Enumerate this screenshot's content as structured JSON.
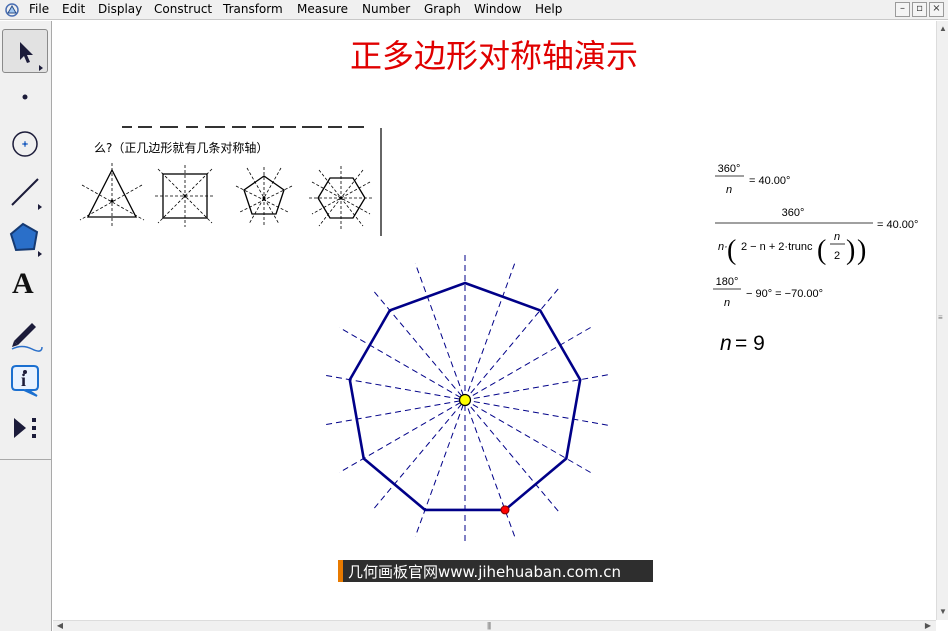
{
  "menu": {
    "items": [
      "File",
      "Edit",
      "Display",
      "Construct",
      "Transform",
      "Measure",
      "Number",
      "Graph",
      "Window",
      "Help"
    ]
  },
  "window_controls": {
    "minimize": "–",
    "restore": "▫",
    "close": "×"
  },
  "toolbox": {
    "tools": [
      {
        "name": "select-arrow-tool",
        "icon": "arrow-icon"
      },
      {
        "name": "point-tool",
        "icon": "point-icon"
      },
      {
        "name": "compass-tool",
        "icon": "circle-icon"
      },
      {
        "name": "straightedge-tool",
        "icon": "segment-icon"
      },
      {
        "name": "polygon-tool",
        "icon": "pentagon-icon"
      },
      {
        "name": "text-tool",
        "icon": "text-A-icon"
      },
      {
        "name": "marker-tool",
        "icon": "pen-icon"
      },
      {
        "name": "information-tool",
        "icon": "info-icon"
      },
      {
        "name": "custom-tool",
        "icon": "play-dots-icon"
      }
    ],
    "text_tool_label": "A"
  },
  "document": {
    "title": "正多边形对称轴演示",
    "question_text": "么?（正几边形就有几条对称轴）",
    "formula1": {
      "numerator": "360°",
      "denominator": "n",
      "result": "= 40.00°"
    },
    "formula2": {
      "numerator": "360°",
      "den_prefix": "n·",
      "den_inner": "2 − n + 2·trunc",
      "frac_num": "n",
      "frac_den": "2",
      "result": "= 40.00°"
    },
    "formula3": {
      "numerator": "180°",
      "denominator": "n",
      "rest": "− 90° = −70.00°"
    },
    "n_label": "n",
    "n_value": "= 9",
    "watermark": "几何画板官网www.jihehuaban.com.cn"
  },
  "geometry": {
    "n_sides": 9
  },
  "colors": {
    "title": "#e00000",
    "polygon": "#000088",
    "axes": "#000088",
    "center_point": "#ffff00",
    "vertex_point": "#ff0000",
    "watermark_bg": "#2e2e2e",
    "watermark_accent": "#e87a00"
  }
}
